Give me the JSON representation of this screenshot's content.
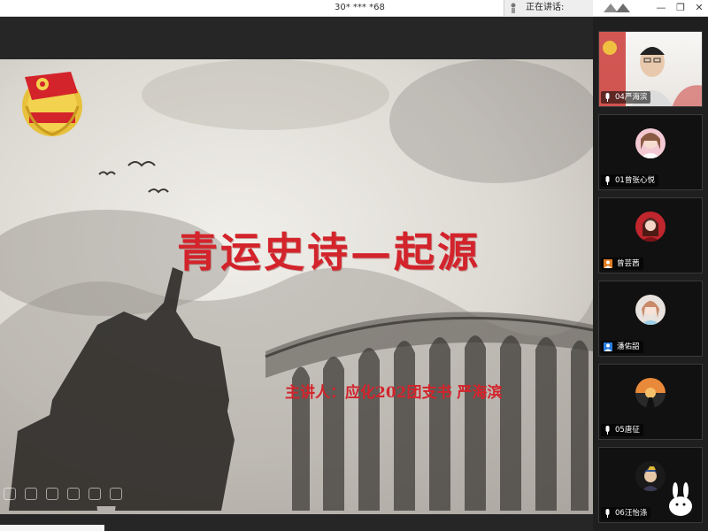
{
  "topbar": {
    "meeting_id": "30* *** *68",
    "speaking_label": "正在讲话:"
  },
  "slide": {
    "title": "青运史诗—起源",
    "speaker_line": "主讲人：应化202团支书  严海滨"
  },
  "participants": [
    {
      "name": "04严海滨",
      "video": true
    },
    {
      "name": "01曾张心悦",
      "video": false
    },
    {
      "name": "曾芸茜",
      "video": false
    },
    {
      "name": "潘佑韶",
      "video": false
    },
    {
      "name": "05唐征",
      "video": false
    },
    {
      "name": "06汪怡涤",
      "video": false
    }
  ],
  "colors": {
    "title_red": "#d3232b",
    "panel_bg": "#1f1f1f"
  }
}
